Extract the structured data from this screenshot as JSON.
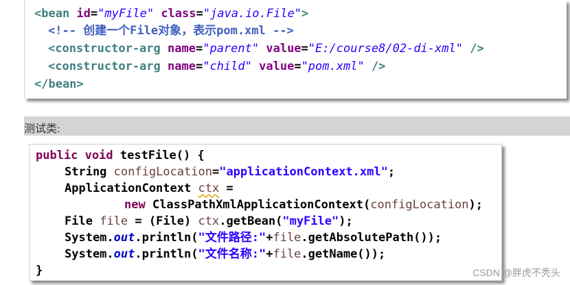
{
  "xml_block": {
    "l1": {
      "open": "<bean",
      "a1": "id",
      "v1": "\"myFile\"",
      "a2": "class",
      "v2": "\"java.io.File\"",
      "close": ">"
    },
    "l2": {
      "comment": "<!-- 创建一个File对象，表示pom.xml -->"
    },
    "l3": {
      "open": "<constructor-arg",
      "a1": "name",
      "v1": "\"parent\"",
      "a2": "value",
      "v2": "\"E:/course8/02-di-xml\"",
      "close": "/>"
    },
    "l4": {
      "open": "<constructor-arg",
      "a1": "name",
      "v1": "\"child\"",
      "a2": "value",
      "v2": "\"pom.xml\"",
      "close": "/>"
    },
    "l5": {
      "close": "</bean>"
    }
  },
  "section_label": "测试类:",
  "java_block": {
    "l1": {
      "kw1": "public",
      "kw2": "void",
      "rest": " testFile() {"
    },
    "l2": {
      "type": "String ",
      "var": "configLocation",
      "eq": "=",
      "str": "\"applicationContext.xml\"",
      "end": ";"
    },
    "l3": {
      "type": "ApplicationContext ",
      "var": "ctx",
      "end": " ="
    },
    "l4": {
      "kw": "new",
      "mid": " ClassPathXmlApplicationContext(",
      "var": "configLocation",
      "end": ");"
    },
    "l5": {
      "pre": "File ",
      "var": "file",
      "mid": " = (File) ",
      "var2": "ctx",
      "call": ".getBean(",
      "str": "\"myFile\"",
      "end": ");"
    },
    "l6": {
      "cls": "System.",
      "fld": "out",
      "call": ".println(",
      "str": "\"文件路径:\"",
      "plus": "+",
      "var": "file",
      "end": ".getAbsolutePath());"
    },
    "l7": {
      "cls": "System.",
      "fld": "out",
      "call": ".println(",
      "str": "\"文件名称:\"",
      "plus": "+",
      "var": "file",
      "end": ".getName());"
    },
    "l8": {
      "close": "}"
    }
  },
  "watermark": "CSDN @胖虎不秃头"
}
